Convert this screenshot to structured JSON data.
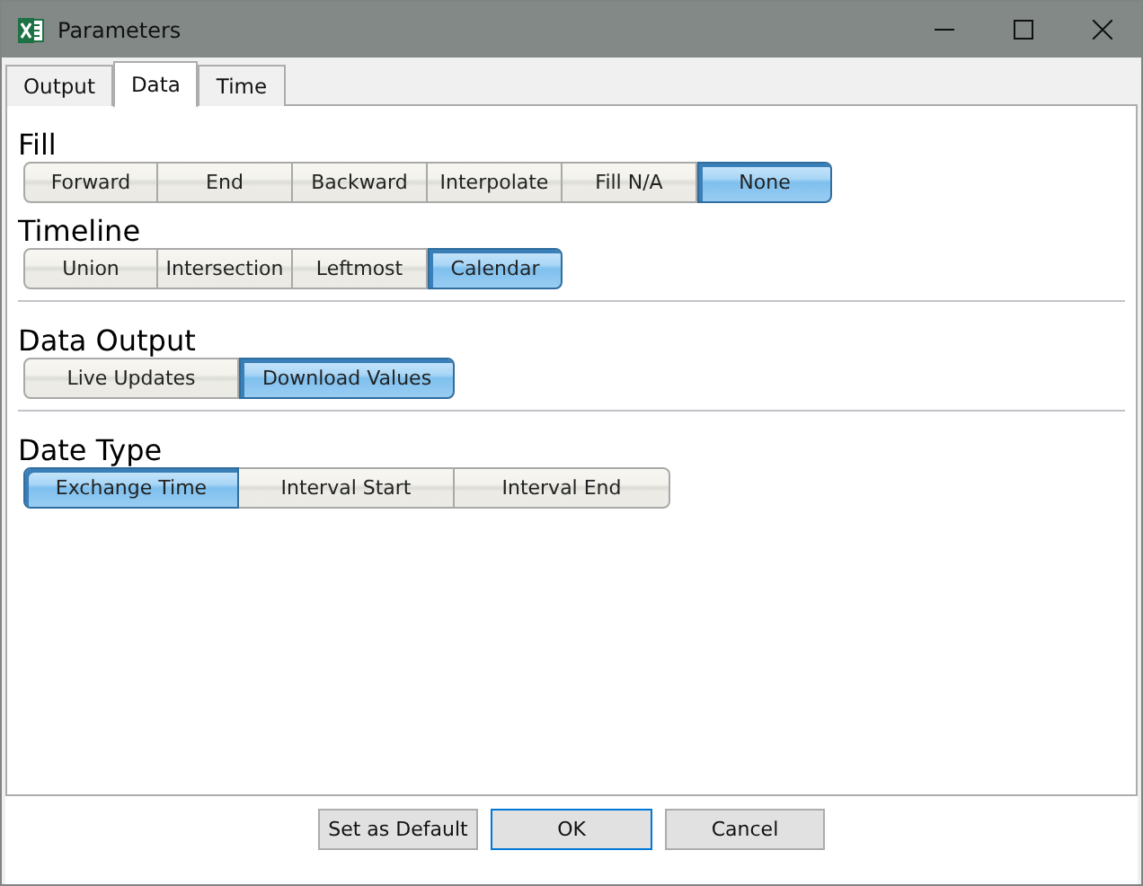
{
  "window": {
    "title": "Parameters"
  },
  "tabs": [
    {
      "label": "Output",
      "selected": false
    },
    {
      "label": "Data",
      "selected": true
    },
    {
      "label": "Time",
      "selected": false
    }
  ],
  "groups": [
    {
      "sections": [
        {
          "label": "Fill",
          "options": [
            {
              "label": "Forward",
              "selected": false
            },
            {
              "label": "End",
              "selected": false
            },
            {
              "label": "Backward",
              "selected": false
            },
            {
              "label": "Interpolate",
              "selected": false
            },
            {
              "label": "Fill N/A",
              "selected": false
            },
            {
              "label": "None",
              "selected": true
            }
          ]
        },
        {
          "label": "Timeline",
          "options": [
            {
              "label": "Union",
              "selected": false
            },
            {
              "label": "Intersection",
              "selected": false
            },
            {
              "label": "Leftmost",
              "selected": false
            },
            {
              "label": "Calendar",
              "selected": true
            }
          ]
        }
      ]
    },
    {
      "sections": [
        {
          "label": "Data Output",
          "options": [
            {
              "label": "Live Updates",
              "selected": false
            },
            {
              "label": "Download Values",
              "selected": true
            }
          ]
        }
      ]
    },
    {
      "sections": [
        {
          "label": "Date Type",
          "options": [
            {
              "label": "Exchange Time",
              "selected": true
            },
            {
              "label": "Interval Start",
              "selected": false
            },
            {
              "label": "Interval End",
              "selected": false
            }
          ]
        }
      ]
    }
  ],
  "buttons": [
    {
      "label": "Set as Default",
      "default": false
    },
    {
      "label": "OK",
      "default": true
    },
    {
      "label": "Cancel",
      "default": false
    }
  ]
}
